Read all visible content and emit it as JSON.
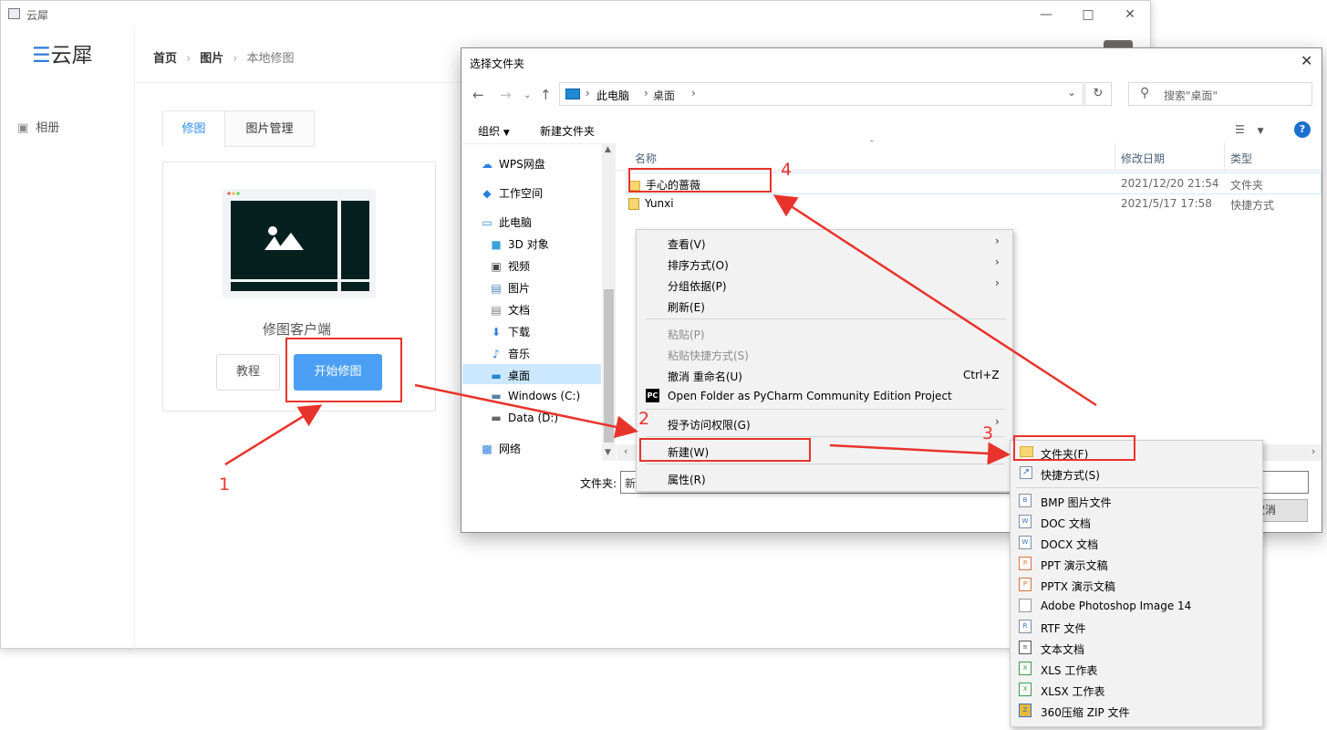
{
  "app": {
    "title": "云犀",
    "logo_text": "云犀",
    "sidebar": {
      "album": "相册"
    },
    "breadcrumb": {
      "home": "首页",
      "images": "图片",
      "current": "本地修图"
    },
    "tabs": {
      "edit": "修图",
      "manage": "图片管理"
    },
    "card": {
      "title": "修图客户端",
      "tutorial_button": "教程",
      "start_button": "开始修图"
    }
  },
  "dialog": {
    "title": "选择文件夹",
    "address": {
      "pc": "此电脑",
      "desktop": "桌面"
    },
    "search_placeholder": "搜索\"桌面\"",
    "toolbar": {
      "organize": "组织",
      "new_folder": "新建文件夹"
    },
    "nav": [
      "WPS网盘",
      "工作空间",
      "此电脑",
      "3D 对象",
      "视频",
      "图片",
      "文档",
      "下载",
      "音乐",
      "桌面",
      "Windows (C:)",
      "Data (D:)",
      "网络"
    ],
    "columns": {
      "name": "名称",
      "date": "修改日期",
      "type": "类型"
    },
    "files": [
      {
        "name": "手心的蔷薇",
        "date": "2021/12/20 21:54",
        "type": "文件夹"
      },
      {
        "name": "Yunxi",
        "date": "2021/5/17 17:58",
        "type": "快捷方式"
      }
    ],
    "folder_label": "文件夹:",
    "folder_value": "新",
    "cancel": "取消"
  },
  "context_menu": {
    "view": "查看(V)",
    "sort": "排序方式(O)",
    "group": "分组依据(P)",
    "refresh": "刷新(E)",
    "paste": "粘贴(P)",
    "paste_shortcut": "粘贴快捷方式(S)",
    "undo": "撤消 重命名(U)",
    "undo_shortcut": "Ctrl+Z",
    "pycharm": "Open Folder as PyCharm Community Edition Project",
    "grant_access": "授予访问权限(G)",
    "new": "新建(W)",
    "properties": "属性(R)"
  },
  "new_submenu": {
    "folder": "文件夹(F)",
    "shortcut": "快捷方式(S)",
    "items": [
      "BMP 图片文件",
      "DOC 文档",
      "DOCX 文档",
      "PPT 演示文稿",
      "PPTX 演示文稿",
      "Adobe Photoshop Image 14",
      "RTF 文件",
      "文本文档",
      "XLS 工作表",
      "XLSX 工作表",
      "360压缩 ZIP 文件"
    ],
    "icons": [
      "bmp-icon",
      "doc-icon",
      "docx-icon",
      "ppt-icon",
      "pptx-icon",
      "psd-icon",
      "rtf-icon",
      "txt-icon",
      "xls-icon",
      "xlsx-icon",
      "zip-icon"
    ]
  },
  "annotations": {
    "step1": "1",
    "step2": "2",
    "step3": "3",
    "step4": "4"
  },
  "colors": {
    "accent": "#4a9ff5",
    "annotation": "#e8332c",
    "selection": "#cce8ff"
  }
}
